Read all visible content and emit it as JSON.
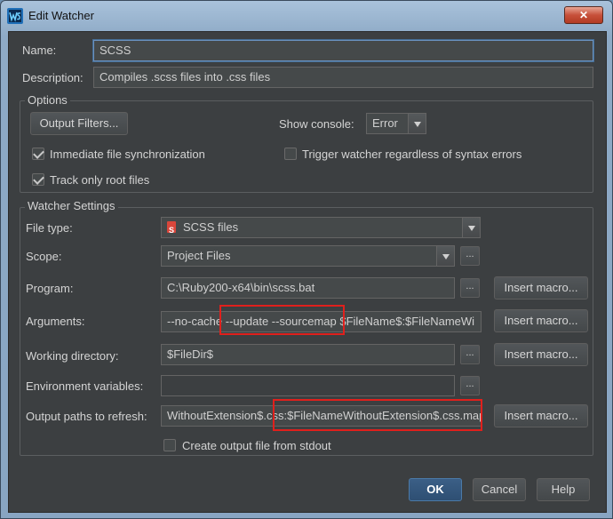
{
  "window": {
    "title": "Edit Watcher",
    "close_label": "✕"
  },
  "name": {
    "label": "Name:",
    "value": "SCSS"
  },
  "description": {
    "label": "Description:",
    "value": "Compiles .scss files into .css files"
  },
  "options": {
    "title": "Options",
    "output_filters_label": "Output Filters...",
    "show_console_label": "Show console:",
    "show_console_value": "Error",
    "immediate_sync_label": "Immediate file synchronization",
    "immediate_sync_checked": true,
    "trigger_watcher_label": "Trigger watcher regardless of syntax errors",
    "trigger_watcher_checked": false,
    "track_root_label": "Track only root files",
    "track_root_checked": true
  },
  "watcher": {
    "title": "Watcher Settings",
    "file_type_label": "File type:",
    "file_type_value": "SCSS files",
    "scope_label": "Scope:",
    "scope_value": "Project Files",
    "program_label": "Program:",
    "program_value": "C:\\Ruby200-x64\\bin\\scss.bat",
    "arguments_label": "Arguments:",
    "arguments_value": "--no-cache --update --sourcemap $FileName$:$FileNameWi",
    "working_dir_label": "Working directory:",
    "working_dir_value": "$FileDir$",
    "env_label": "Environment variables:",
    "env_value": "",
    "output_paths_label": "Output paths to refresh:",
    "output_paths_value": "WithoutExtension$.css:$FileNameWithoutExtension$.css.map",
    "insert_macro_label": "Insert macro...",
    "dots_label": "...",
    "create_output_label": "Create output file from stdout",
    "create_output_checked": false
  },
  "footer": {
    "ok_label": "OK",
    "cancel_label": "Cancel",
    "help_label": "Help"
  },
  "colors": {
    "panel_bg": "#3c3f41",
    "highlight": "#e0201c",
    "focus_border": "#6a91bf"
  }
}
